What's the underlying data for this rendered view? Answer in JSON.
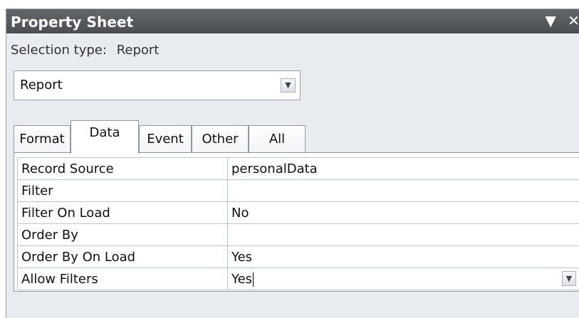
{
  "window": {
    "title": "Property Sheet",
    "dropdown_icon": "▼",
    "close_icon": "✕"
  },
  "selection": {
    "label": "Selection type:",
    "value": "Report"
  },
  "object_combo": {
    "value": "Report"
  },
  "tabs": [
    {
      "label": "Format",
      "active": false
    },
    {
      "label": "Data",
      "active": true
    },
    {
      "label": "Event",
      "active": false
    },
    {
      "label": "Other",
      "active": false
    },
    {
      "label": "All",
      "active": false
    }
  ],
  "properties": [
    {
      "name": "Record Source",
      "value": "personalData"
    },
    {
      "name": "Filter",
      "value": ""
    },
    {
      "name": "Filter On Load",
      "value": "No"
    },
    {
      "name": "Order By",
      "value": ""
    },
    {
      "name": "Order By On Load",
      "value": "Yes"
    },
    {
      "name": "Allow Filters",
      "value": "Yes"
    }
  ],
  "colors": {
    "titlebar": "#55585c",
    "panel_bg": "#e8ebef",
    "border": "#8e98a3"
  }
}
